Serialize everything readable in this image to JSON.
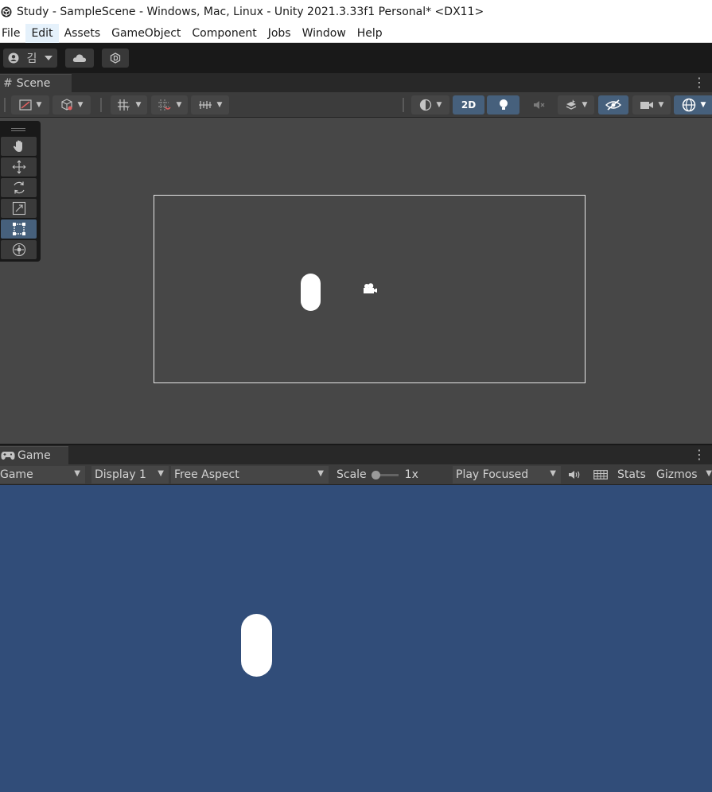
{
  "window": {
    "title": "Study - SampleScene - Windows, Mac, Linux - Unity 2021.3.33f1 Personal* <DX11>"
  },
  "menubar": {
    "items": [
      "File",
      "Edit",
      "Assets",
      "GameObject",
      "Component",
      "Jobs",
      "Window",
      "Help"
    ]
  },
  "toolbar": {
    "account_label": "김",
    "account_icon": "account-icon",
    "cloud_icon": "cloud-icon",
    "collab_icon": "collab-icon"
  },
  "scene": {
    "tab_label": "Scene",
    "tab_icon": "grid-hash-icon",
    "mode_2d_label": "2D",
    "mode_2d_active": true,
    "lighting_active": true
  },
  "tools": {
    "items": [
      "hand-tool",
      "move-tool",
      "rotate-tool",
      "scale-tool",
      "rect-tool",
      "transform-tool"
    ],
    "active": "rect-tool"
  },
  "game": {
    "tab_label": "Game",
    "tab_icon": "gamepad-icon",
    "view_select": "Game",
    "display_select": "Display 1",
    "aspect_select": "Free Aspect",
    "scale_label": "Scale",
    "scale_value": "1x",
    "play_mode_select": "Play Focused",
    "stats_label": "Stats",
    "gizmos_label": "Gizmos"
  },
  "colors": {
    "game_background": "#314d79",
    "scene_background": "#474747",
    "active_button": "#46607c",
    "title_bar": "#ffffff",
    "menu_hover": "#e5f1fb"
  }
}
